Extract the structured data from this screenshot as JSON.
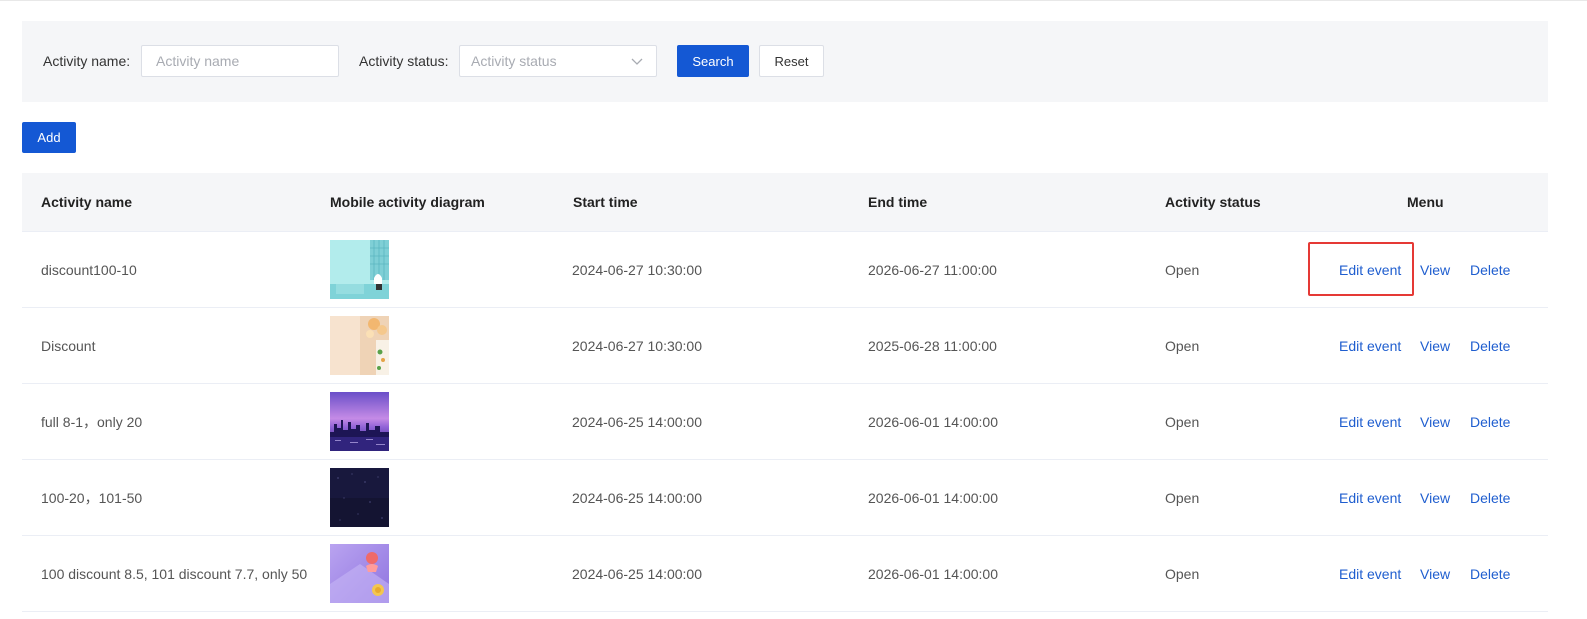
{
  "search": {
    "activity_name_label": "Activity name:",
    "activity_name_placeholder": "Activity name",
    "activity_status_label": "Activity status:",
    "activity_status_placeholder": "Activity status",
    "search_button": "Search",
    "reset_button": "Reset"
  },
  "toolbar": {
    "add_button": "Add"
  },
  "table": {
    "headers": {
      "activity_name": "Activity name",
      "diagram": "Mobile activity diagram",
      "start_time": "Start time",
      "end_time": "End time",
      "status": "Activity status",
      "menu": "Menu"
    },
    "actions": {
      "edit": "Edit event",
      "view": "View",
      "delete": "Delete"
    },
    "rows": [
      {
        "name": "discount100-10",
        "start": "2024-06-27 10:30:00",
        "end": "2026-06-27 11:00:00",
        "status": "Open",
        "thumb": "thumb-aqua-room"
      },
      {
        "name": "Discount",
        "start": "2024-06-27 10:30:00",
        "end": "2025-06-28 11:00:00",
        "status": "Open",
        "thumb": "thumb-peach-balloons"
      },
      {
        "name": "full 8-1，only 20",
        "start": "2024-06-25 14:00:00",
        "end": "2026-06-01 14:00:00",
        "status": "Open",
        "thumb": "thumb-purple-skyline"
      },
      {
        "name": "100-20，101-50",
        "start": "2024-06-25 14:00:00",
        "end": "2026-06-01 14:00:00",
        "status": "Open",
        "thumb": "thumb-night-sky"
      },
      {
        "name": "100 discount 8.5, 101 discount 7.7, only 50",
        "start": "2024-06-25 14:00:00",
        "end": "2026-06-01 14:00:00",
        "status": "Open",
        "thumb": "thumb-lavender-gift"
      }
    ]
  },
  "colors": {
    "primary": "#1458d4",
    "link": "#1f5ecf",
    "highlight": "#e53935",
    "panel_bg": "#f5f6f8"
  }
}
